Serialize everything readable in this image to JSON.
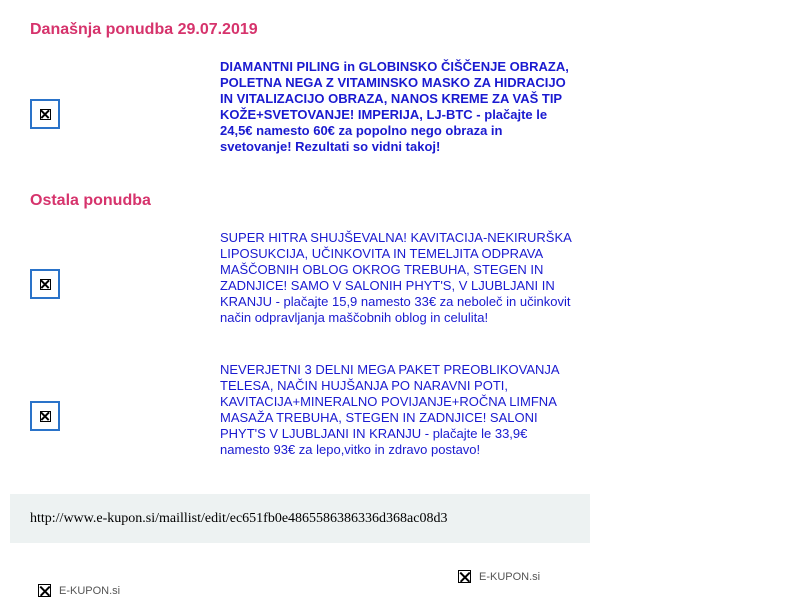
{
  "today": {
    "heading": "Današnja ponudba 29.07.2019",
    "offer": {
      "text": "DIAMANTNI PILING in GLOBINSKO ČIŠČENJE OBRAZA, POLETNA NEGA Z VITAMINSKO MASKO ZA HIDRACIJO IN VITALIZACIJO OBRAZA, NANOS KREME ZA VAŠ TIP KOŽE+SVETOVANJE! IMPERIJA, LJ-BTC - plačajte le 24,5€ namesto 60€ za popolno nego obraza in svetovanje! Rezultati so vidni takoj!"
    }
  },
  "other": {
    "heading": "Ostala ponudba",
    "offers": [
      {
        "text": "SUPER HITRA SHUJŠEVALNA! KAVITACIJA-NEKIRURŠKA LIPOSUKCIJA, UČINKOVITA IN TEMELJITA ODPRAVA MAŠČOBNIH OBLOG OKROG TREBUHA, STEGEN IN ZADNJICE! SAMO V SALONIH PHYT'S, V LJUBLJANI IN KRANJU - plačajte 15,9 namesto 33€ za neboleč in učinkovit način odpravljanja maščobnih oblog in celulita!"
      },
      {
        "text": "NEVERJETNI 3 DELNI MEGA PAKET PREOBLIKOVANJA TELESA, NAČIN HUJŠANJA PO NARAVNI POTI, KAVITACIJA+MINERALNO POVIJANJE+ROČNA LIMFNA MASAŽA TREBUHA, STEGEN IN ZADNJICE! SALONI PHYT'S V LJUBLJANI IN KRANJU - plačajte le 33,9€ namesto 93€ za lepo,vitko in zdravo postavo!"
      }
    ]
  },
  "maillist": {
    "url": "http://www.e-kupon.si/maillist/edit/ec651fb0e4865586386336d368ac08d3"
  },
  "footer": {
    "logo_left": "E-KUPON.si",
    "logo_right": "E-KUPON.si"
  }
}
